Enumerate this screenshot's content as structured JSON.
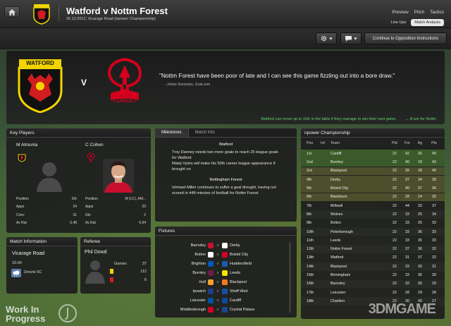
{
  "header": {
    "title": "Watford v Nottm Forest",
    "subtitle": "26.12.2012, Vicarage Road (npower Championship)",
    "nav": [
      "Preview",
      "Pitch",
      "Tactics"
    ],
    "tabs": [
      {
        "label": "Line Ups",
        "active": false
      },
      {
        "label": "Match Analysis",
        "active": true
      }
    ]
  },
  "toolbar": {
    "continue_label": "Continue to Opposition Instructions"
  },
  "hero": {
    "home_crest_text": "WATFORD",
    "away_crest_text": "FOREST",
    "vs": "V",
    "quote": "\"Nottm Forest have been poor of late and I can see this game fizzling out into a bore draw.\"",
    "attribution": "- Johan Svensson, Goal.com",
    "info_left": "Watford can move up to 11th in the table if they manage to win their next game.",
    "info_right": "→ A win for Nottm"
  },
  "key_players": {
    "title": "Key Players",
    "players": [
      {
        "name": "M Almunia",
        "position": "GK",
        "apps": "24",
        "goals_label": "Conc",
        "goals": "31",
        "av_rat": "6.48"
      },
      {
        "name": "C Cohen",
        "position": "M (LC), AM...",
        "apps": "23",
        "goals_label": "Gls",
        "goals": "2",
        "av_rat": "6.94"
      }
    ],
    "labels": {
      "position": "Position",
      "apps": "Apps",
      "av_rat": "Av Rat"
    }
  },
  "milestones": {
    "tabs": [
      {
        "label": "Milestones",
        "active": true
      },
      {
        "label": "Match Info",
        "active": false
      }
    ],
    "home_team": "Watford",
    "home_notes": [
      "Troy Deeney needs two more goals to reach 25 league goals for Watford",
      "Matej Vydra will make his 50th career league appearance if brought on"
    ],
    "away_team": "Nottingham Forest",
    "away_notes": [
      "Ishmael Miller continues to suffer a goal drought, having not scored in 448 minutes of football for Nottm Forest"
    ]
  },
  "fixtures": {
    "title": "Fixtures",
    "vs": "v",
    "rows": [
      {
        "home": "Barnsley",
        "away": "Derby",
        "hc": "#c8102e",
        "ac": "#ffffff"
      },
      {
        "home": "Bolton",
        "away": "Bristol City",
        "hc": "#ffffff",
        "ac": "#d4002a"
      },
      {
        "home": "Brighton",
        "away": "Huddersfield",
        "hc": "#0057b8",
        "ac": "#1a5cb0"
      },
      {
        "home": "Burnley",
        "away": "Leeds",
        "hc": "#6c1d45",
        "ac": "#f2e600"
      },
      {
        "home": "Hull",
        "away": "Blackpool",
        "hc": "#f5a12d",
        "ac": "#f47a20"
      },
      {
        "home": "Ipswich",
        "away": "Sheff Wed",
        "hc": "#1f3d8c",
        "ac": "#1a4ea8"
      },
      {
        "home": "Leicester",
        "away": "Cardiff",
        "hc": "#0053a0",
        "ac": "#0a4aa0"
      },
      {
        "home": "Middlesbrough",
        "away": "Crystal Palace",
        "hc": "#d4002a",
        "ac": "#1b458f"
      }
    ]
  },
  "league_table": {
    "title": "npower Championship",
    "headers": [
      "Pos",
      "Inf",
      "Team",
      "Pld",
      "For",
      "Ag",
      "Pts"
    ],
    "rows": [
      {
        "pos": "1st",
        "team": "Cardiff",
        "pld": "22",
        "for": "42",
        "ag": "26",
        "pts": "45",
        "zone": "green"
      },
      {
        "pos": "2nd",
        "team": "Burnley",
        "pld": "22",
        "for": "40",
        "ag": "29",
        "pts": "43",
        "zone": "green"
      },
      {
        "pos": "3rd",
        "team": "Blackpool",
        "pld": "22",
        "for": "39",
        "ag": "28",
        "pts": "40",
        "zone": "olive"
      },
      {
        "pos": "4th",
        "team": "Derby",
        "pld": "22",
        "for": "37",
        "ag": "34",
        "pts": "39",
        "zone": "olive"
      },
      {
        "pos": "5th",
        "team": "Bristol City",
        "pld": "22",
        "for": "40",
        "ag": "37",
        "pts": "36",
        "zone": "olive"
      },
      {
        "pos": "6th",
        "team": "Blackburn",
        "pld": "22",
        "for": "28",
        "ag": "24",
        "pts": "35",
        "zone": "olive"
      },
      {
        "pos": "7th",
        "team": "Millwall",
        "pld": "22",
        "for": "44",
        "ag": "33",
        "pts": "37",
        "zone": ""
      },
      {
        "pos": "8th",
        "team": "Wolves",
        "pld": "22",
        "for": "33",
        "ag": "25",
        "pts": "34",
        "zone": ""
      },
      {
        "pos": "9th",
        "team": "Bolton",
        "pld": "22",
        "for": "33",
        "ag": "25",
        "pts": "33",
        "zone": ""
      },
      {
        "pos": "10th",
        "team": "Peterborough",
        "pld": "22",
        "for": "33",
        "ag": "36",
        "pts": "33",
        "zone": ""
      },
      {
        "pos": "11th",
        "team": "Leeds",
        "pld": "22",
        "for": "33",
        "ag": "35",
        "pts": "33",
        "zone": ""
      },
      {
        "pos": "12th",
        "team": "Nottm Forest",
        "pld": "22",
        "for": "37",
        "ag": "36",
        "pts": "32",
        "zone": ""
      },
      {
        "pos": "13th",
        "team": "Watford",
        "pld": "22",
        "for": "31",
        "ag": "37",
        "pts": "32",
        "zone": ""
      },
      {
        "pos": "14th",
        "team": "Blackpool",
        "pld": "22",
        "for": "33",
        "ag": "30",
        "pts": "31",
        "zone": ""
      },
      {
        "pos": "15th",
        "team": "Birmingham",
        "pld": "22",
        "for": "33",
        "ag": "36",
        "pts": "30",
        "zone": ""
      },
      {
        "pos": "16th",
        "team": "Barnsley",
        "pld": "22",
        "for": "32",
        "ag": "36",
        "pts": "29",
        "zone": ""
      },
      {
        "pos": "17th",
        "team": "Leicester",
        "pld": "22",
        "for": "28",
        "ag": "29",
        "pts": "28",
        "zone": ""
      },
      {
        "pos": "18th",
        "team": "Charlton",
        "pld": "22",
        "for": "30",
        "ag": "40",
        "pts": "27",
        "zone": ""
      }
    ]
  },
  "match_info": {
    "title": "Match Information",
    "venue": "Vicarage Road",
    "time": "15:00",
    "weather": "Drizzle 5C"
  },
  "referee": {
    "title": "Referee",
    "name": "Phil Dowd",
    "games_label": "Games",
    "games": "37",
    "yellows": "112",
    "reds": "6"
  },
  "watermark": {
    "line1": "Work In",
    "line2": "Progress",
    "site": "3DMGAME"
  },
  "colors": {
    "accent_green": "#62d46a",
    "zone_green": "#3b5a2b",
    "zone_olive": "#4d4f2c",
    "panel": "#1e1e1e"
  }
}
